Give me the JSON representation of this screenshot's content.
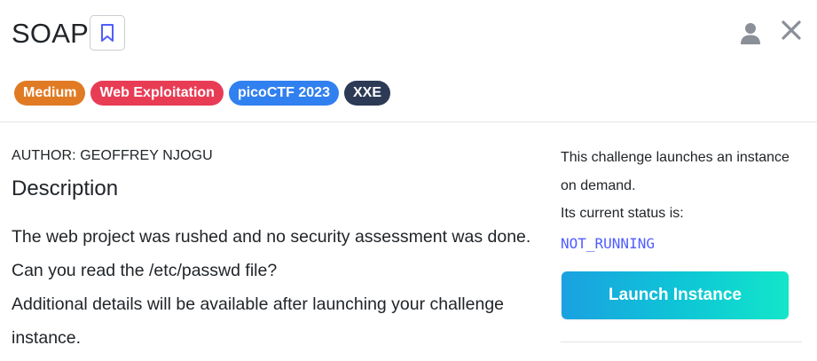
{
  "challenge": {
    "title": "SOAP",
    "tags": [
      {
        "label": "Medium",
        "color": "#e07b24"
      },
      {
        "label": "Web Exploitation",
        "color": "#e83c55"
      },
      {
        "label": "picoCTF 2023",
        "color": "#3180f0"
      },
      {
        "label": "XXE",
        "color": "#2c3a56"
      }
    ],
    "author": "AUTHOR: GEOFFREY NJOGU",
    "description_heading": "Description",
    "description_lines": [
      "The web project was rushed and no security assessment was done. Can you read the /etc/passwd file?",
      "Additional details will be available after launching your challenge instance."
    ]
  },
  "instance": {
    "info_line1": "This challenge launches an instance on demand.",
    "info_line2": "Its current status is:",
    "status": "NOT_RUNNING",
    "launch_label": "Launch Instance"
  },
  "icons": {
    "bookmark": "bookmark-icon",
    "user": "user-icon",
    "close": "close-icon"
  },
  "colors": {
    "status_text": "#4f5dff",
    "launch_gradient_start": "#1aa1e0",
    "launch_gradient_end": "#12e6c9"
  }
}
